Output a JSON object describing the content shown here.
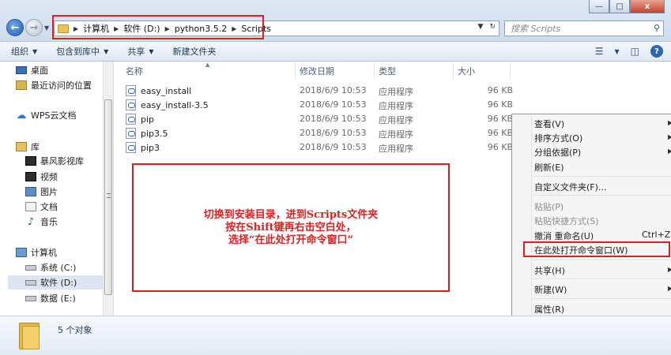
{
  "window": {
    "controls": {
      "minimize": "—",
      "maximize": "□",
      "close": "x"
    }
  },
  "address": {
    "crumbs": [
      "计算机",
      "软件 (D:)",
      "python3.5.2",
      "Scripts"
    ]
  },
  "search": {
    "placeholder": "搜索 Scripts"
  },
  "toolbar": {
    "organize": "组织",
    "include_library": "包含到库中",
    "share": "共享",
    "new_folder": "新建文件夹"
  },
  "nav": {
    "desktop": "桌面",
    "recent": "最近访问的位置",
    "wps_cloud": "WPS云文档",
    "libraries": "库",
    "storm_video": "暴风影视库",
    "videos": "视频",
    "pictures": "图片",
    "documents": "文档",
    "music": "音乐",
    "computer": "计算机",
    "drive_c": "系统 (C:)",
    "drive_d": "软件 (D:)",
    "drive_e": "数据 (E:)"
  },
  "columns": {
    "name": "名称",
    "date": "修改日期",
    "type": "类型",
    "size": "大小"
  },
  "files": [
    {
      "name": "easy_install",
      "date": "2018/6/9 10:53",
      "type": "应用程序",
      "size": "96 KB"
    },
    {
      "name": "easy_install-3.5",
      "date": "2018/6/9 10:53",
      "type": "应用程序",
      "size": "96 KB"
    },
    {
      "name": "pip",
      "date": "2018/6/9 10:53",
      "type": "应用程序",
      "size": "96 KB"
    },
    {
      "name": "pip3.5",
      "date": "2018/6/9 10:53",
      "type": "应用程序",
      "size": "96 KB"
    },
    {
      "name": "pip3",
      "date": "2018/6/9 10:53",
      "type": "应用程序",
      "size": "96 KB"
    }
  ],
  "annotation": {
    "line1": "切换到安装目录，进到Scripts文件夹",
    "line2": "按在Shift键再右击空白处，",
    "line3": "选择“在此处打开命令窗口”"
  },
  "context_menu": {
    "view": "查看(V)",
    "sort_by": "排序方式(O)",
    "group_by": "分组依据(P)",
    "refresh": "刷新(E)",
    "customize_folder": "自定义文件夹(F)...",
    "paste": "粘贴(P)",
    "paste_shortcut": "粘贴快捷方式(S)",
    "undo_rename": "撤消 重命名(U)",
    "undo_shortcut": "Ctrl+Z",
    "open_cmd_here": "在此处打开命令窗口(W)",
    "share_with": "共享(H)",
    "new": "新建(W)",
    "properties": "属性(R)"
  },
  "details": {
    "count": "5 个对象"
  },
  "colors": {
    "highlight_red": "#e02020",
    "accent_blue": "#2f67b3"
  }
}
